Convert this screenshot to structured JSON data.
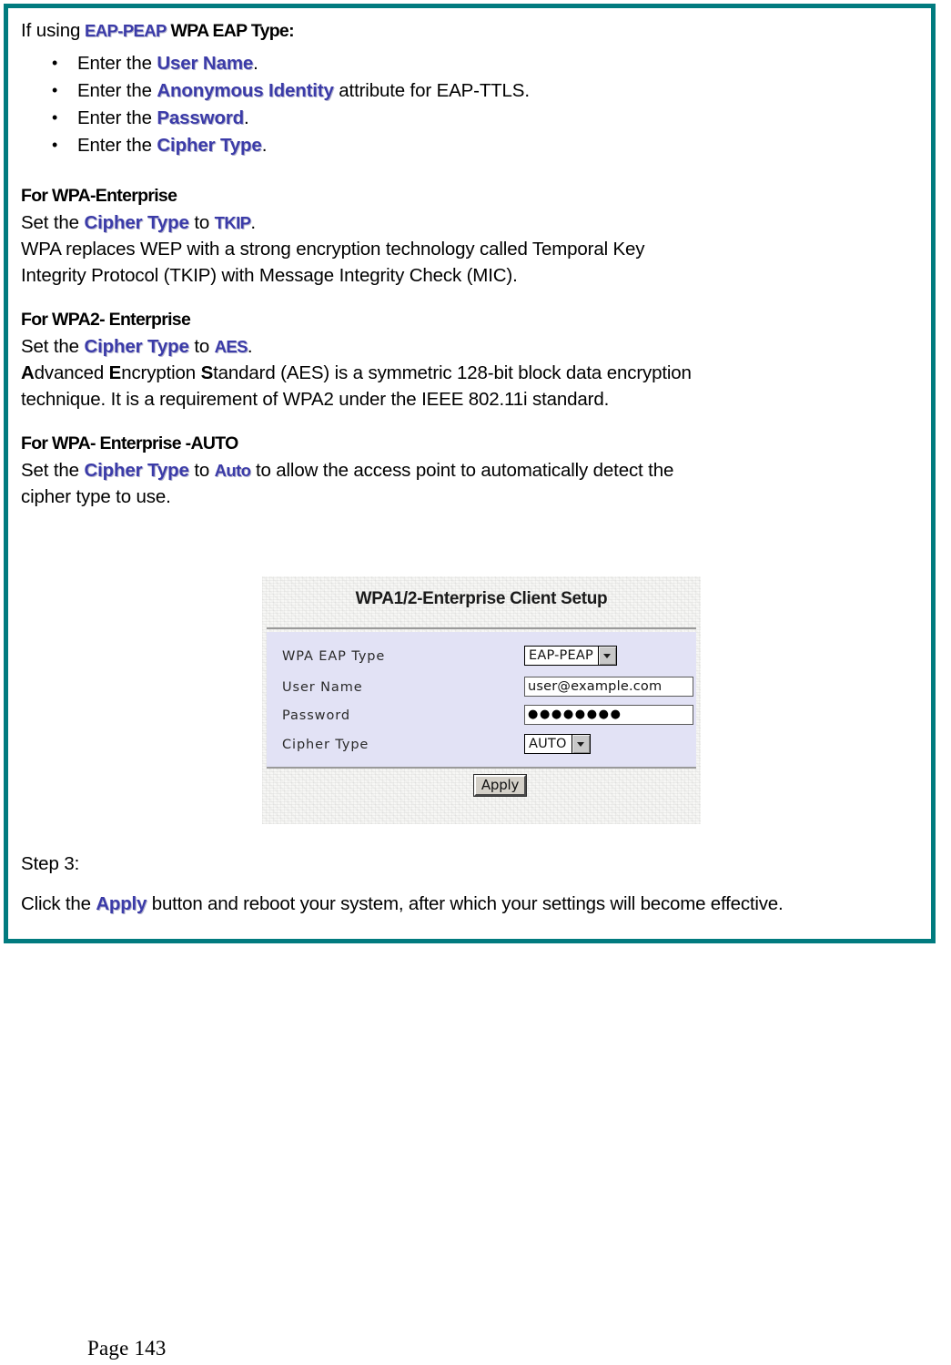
{
  "document": {
    "page_label": "Page 143",
    "accent_border_color": "#017b7f",
    "keyword_color": "#3b3ba8"
  },
  "intro": {
    "lead": "If using",
    "eap_type": "EAP-PEAP",
    "lead_tail": "WPA EAP Type:",
    "bullets": [
      {
        "prefix": "Enter the",
        "term": "User Name",
        "suffix": "."
      },
      {
        "prefix": "Enter the",
        "term": "Anonymous Identity",
        "suffix": "attribute for EAP-TTLS."
      },
      {
        "prefix": "Enter the",
        "term": "Password",
        "suffix": "."
      },
      {
        "prefix": "Enter the",
        "term": "Cipher Type",
        "suffix": "."
      }
    ]
  },
  "sections": [
    {
      "heading": "For WPA-Enterprise",
      "set_prefix": "Set the",
      "set_term": "Cipher Type",
      "set_to": "to",
      "set_value": "TKIP",
      "set_suffix": ".",
      "body_line1": "WPA replaces WEP with a strong encryption technology called Temporal Key",
      "body_line2": "Integrity Protocol (TKIP) with Message Integrity Check (MIC)."
    },
    {
      "heading": "For WPA2- Enterprise",
      "set_prefix": "Set the",
      "set_term": "Cipher Type",
      "set_to": "to",
      "set_value": "AES",
      "set_suffix": ".",
      "body_line1_a": "A",
      "body_line1_b": "dvanced ",
      "body_line1_c": "E",
      "body_line1_d": "ncryption ",
      "body_line1_e": "S",
      "body_line1_f": "tandard (AES) is a symmetric 128-bit block data encryption",
      "body_line2": "technique. It is a requirement of WPA2 under the IEEE 802.11i standard."
    },
    {
      "heading": "For WPA- Enterprise -AUTO",
      "set_prefix": "Set the",
      "set_term": "Cipher Type",
      "set_to": "to",
      "set_value": "Auto",
      "set_suffix": "to allow the access point to automatically detect the",
      "body_line2": "cipher type to use."
    }
  ],
  "screenshot": {
    "title": "WPA1/2-Enterprise Client Setup",
    "rows": [
      {
        "label": "WPA EAP Type",
        "type": "select",
        "value": "EAP-PEAP"
      },
      {
        "label": "User Name",
        "type": "text",
        "value": "user@example.com"
      },
      {
        "label": "Password",
        "type": "password",
        "value": "●●●●●●●●"
      },
      {
        "label": "Cipher Type",
        "type": "select",
        "value": "AUTO"
      }
    ],
    "apply_label": "Apply"
  },
  "step": {
    "label": "Step 3:",
    "body_prefix": "Click the",
    "body_term": "Apply",
    "body_suffix": "button and reboot your system, after which your settings will become effective."
  }
}
